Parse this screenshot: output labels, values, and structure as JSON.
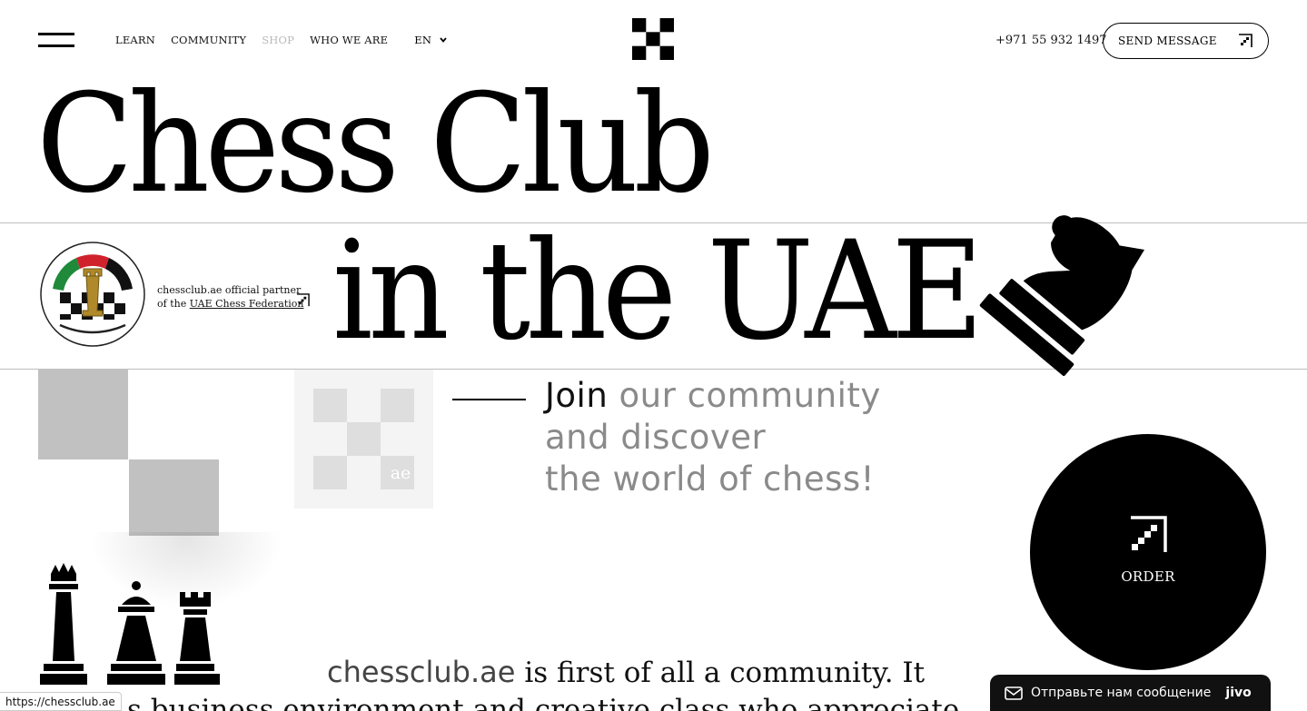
{
  "header": {
    "menu_icon": "hamburger-icon",
    "nav": [
      {
        "label": "LEARN"
      },
      {
        "label": "COMMUNITY"
      },
      {
        "label": "SHOP"
      },
      {
        "label": "WHO WE ARE"
      }
    ],
    "language": "EN",
    "logo_icon": "checker-logo-icon",
    "phone": "+971 55 932 1497",
    "send_message": "SEND MESSAGE"
  },
  "hero": {
    "title_line1": "Chess Club",
    "title_line2": "in the UAE",
    "partner_text": "chessclub.ae official partner",
    "partner_prefix": "of the",
    "partner_link": "UAE Chess Federation",
    "tile_text": "ae",
    "join_dark": "Join",
    "join_rest_1": "our community",
    "join_line2": "and discover",
    "join_line3": "the world of chess!"
  },
  "order": {
    "label": "ORDER"
  },
  "about": {
    "brand": "chessclub.ae",
    "text1": "is first of all a community. It",
    "text2": "s business environment and creative class who appreciate"
  },
  "status_url": "https://chessclub.ae",
  "chat": {
    "message": "Отправьте нам сообщение",
    "brand": "jivo"
  },
  "colors": {
    "accent": "#000000",
    "muted_text": "#8a8a8a",
    "square": "#c1c1c1"
  }
}
